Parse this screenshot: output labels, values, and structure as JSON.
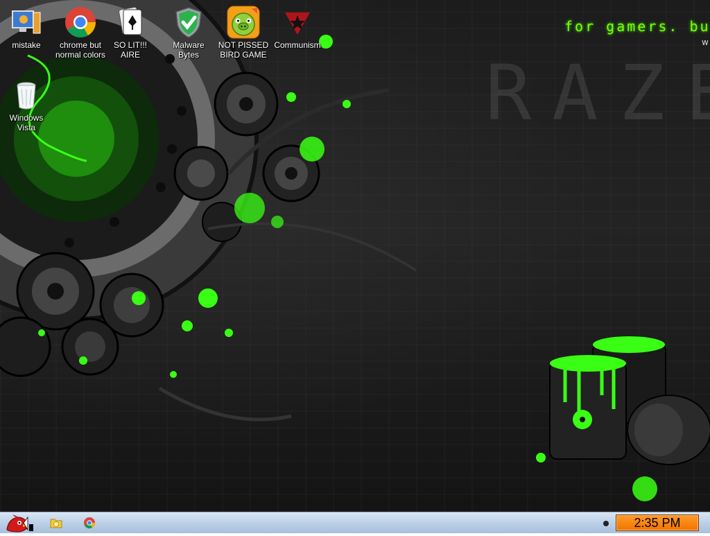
{
  "wallpaper": {
    "tagline": "for gamers. bu",
    "tagline_sub": "w",
    "watermark": "RAZE",
    "accent_color": "#39ff14"
  },
  "desktop_icons": [
    {
      "label": "mistake",
      "icon": "computer-icon"
    },
    {
      "label": "chrome but normal colors",
      "icon": "chrome-icon"
    },
    {
      "label": "SO LIT!!! AIRE",
      "icon": "solitaire-icon"
    },
    {
      "label": "Malware Bytes",
      "icon": "shield-check-icon"
    },
    {
      "label": "NOT PISSED BIRD GAME",
      "icon": "pig-icon"
    },
    {
      "label": "Communism",
      "icon": "star-logo-icon"
    },
    {
      "label": "Windows Vista",
      "icon": "recycle-bin-icon"
    }
  ],
  "taskbar": {
    "start_icon": "angry-bird-icon",
    "pinned": [
      {
        "name": "explorer",
        "icon": "folder-icon"
      },
      {
        "name": "chrome",
        "icon": "chrome-icon"
      }
    ],
    "clock": "2:35 PM"
  }
}
